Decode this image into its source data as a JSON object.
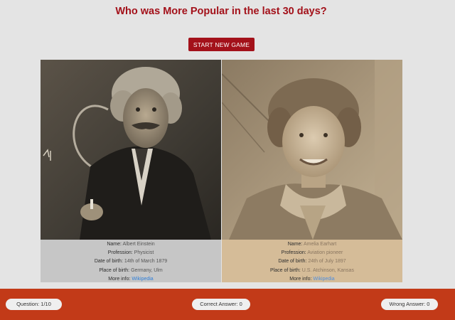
{
  "header": {
    "title": "Who was More Popular in the last 30 days?",
    "start_button": "START NEW GAME"
  },
  "cards": [
    {
      "name_label": "Name:",
      "name": "Albert Einstein",
      "profession_label": "Profession:",
      "profession": "Physicist",
      "birth_date_label": "Date of birth:",
      "birth_date": "14th of March 1879",
      "birth_place_label": "Place of birth:",
      "birth_place": "Germany, Ulm",
      "more_info_label": "More info:",
      "more_info_link": "Wikipedia"
    },
    {
      "name_label": "Name:",
      "name": "Amelia Earhart",
      "profession_label": "Profession:",
      "profession": "Aviation pioneer",
      "birth_date_label": "Date of birth:",
      "birth_date": "24th of July 1897",
      "birth_place_label": "Place of birth:",
      "birth_place": "U.S. Atchinson, Kansas",
      "more_info_label": "More info:",
      "more_info_link": "Wikipedia"
    }
  ],
  "footer": {
    "question": "Question: 1/10",
    "correct": "Correct Answer: 0",
    "wrong": "Wrong Answer: 0"
  },
  "colors": {
    "accent": "#a3111a",
    "footer_bg": "#c23a18",
    "left_info_bg": "#c6c6c6",
    "right_info_bg": "#d5bc98",
    "link": "#2f7fd9"
  }
}
